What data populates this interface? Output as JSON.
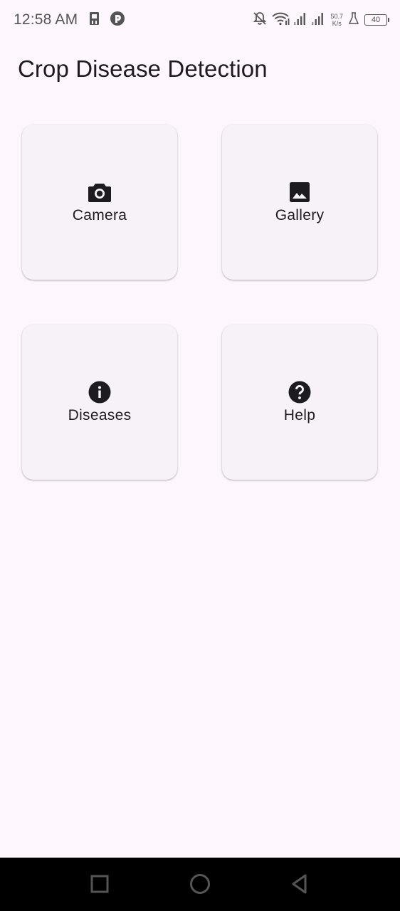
{
  "status_bar": {
    "time": "12:58 AM",
    "net_speed_value": "50.7",
    "net_speed_unit": "K/s",
    "battery_level": "40",
    "icons": [
      "sim-icon",
      "app-icon",
      "bell-off-icon",
      "wifi-icon",
      "signal-icon",
      "signal-icon",
      "flask-icon",
      "battery-icon"
    ]
  },
  "app_bar": {
    "title": "Crop Disease Detection"
  },
  "cards": {
    "camera": {
      "label": "Camera",
      "icon": "camera-icon"
    },
    "gallery": {
      "label": "Gallery",
      "icon": "image-icon"
    },
    "diseases": {
      "label": "Diseases",
      "icon": "info-icon"
    },
    "help": {
      "label": "Help",
      "icon": "help-icon"
    }
  },
  "nav_bar": {
    "buttons": [
      "recents-button",
      "home-button",
      "back-button"
    ]
  },
  "colors": {
    "background": "#FDF7FD",
    "card": "#F7F2F7",
    "text": "#1D1B20",
    "nav_bar": "#000000"
  }
}
